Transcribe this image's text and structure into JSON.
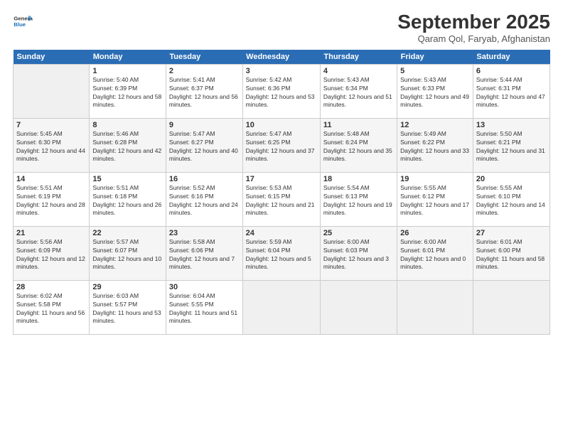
{
  "logo": {
    "general": "General",
    "blue": "Blue"
  },
  "title": "September 2025",
  "subtitle": "Qaram Qol, Faryab, Afghanistan",
  "headers": [
    "Sunday",
    "Monday",
    "Tuesday",
    "Wednesday",
    "Thursday",
    "Friday",
    "Saturday"
  ],
  "weeks": [
    [
      {
        "num": "",
        "rise": "",
        "set": "",
        "daylight": "",
        "empty": true
      },
      {
        "num": "1",
        "rise": "Sunrise: 5:40 AM",
        "set": "Sunset: 6:39 PM",
        "daylight": "Daylight: 12 hours and 58 minutes."
      },
      {
        "num": "2",
        "rise": "Sunrise: 5:41 AM",
        "set": "Sunset: 6:37 PM",
        "daylight": "Daylight: 12 hours and 56 minutes."
      },
      {
        "num": "3",
        "rise": "Sunrise: 5:42 AM",
        "set": "Sunset: 6:36 PM",
        "daylight": "Daylight: 12 hours and 53 minutes."
      },
      {
        "num": "4",
        "rise": "Sunrise: 5:43 AM",
        "set": "Sunset: 6:34 PM",
        "daylight": "Daylight: 12 hours and 51 minutes."
      },
      {
        "num": "5",
        "rise": "Sunrise: 5:43 AM",
        "set": "Sunset: 6:33 PM",
        "daylight": "Daylight: 12 hours and 49 minutes."
      },
      {
        "num": "6",
        "rise": "Sunrise: 5:44 AM",
        "set": "Sunset: 6:31 PM",
        "daylight": "Daylight: 12 hours and 47 minutes."
      }
    ],
    [
      {
        "num": "7",
        "rise": "Sunrise: 5:45 AM",
        "set": "Sunset: 6:30 PM",
        "daylight": "Daylight: 12 hours and 44 minutes."
      },
      {
        "num": "8",
        "rise": "Sunrise: 5:46 AM",
        "set": "Sunset: 6:28 PM",
        "daylight": "Daylight: 12 hours and 42 minutes."
      },
      {
        "num": "9",
        "rise": "Sunrise: 5:47 AM",
        "set": "Sunset: 6:27 PM",
        "daylight": "Daylight: 12 hours and 40 minutes."
      },
      {
        "num": "10",
        "rise": "Sunrise: 5:47 AM",
        "set": "Sunset: 6:25 PM",
        "daylight": "Daylight: 12 hours and 37 minutes."
      },
      {
        "num": "11",
        "rise": "Sunrise: 5:48 AM",
        "set": "Sunset: 6:24 PM",
        "daylight": "Daylight: 12 hours and 35 minutes."
      },
      {
        "num": "12",
        "rise": "Sunrise: 5:49 AM",
        "set": "Sunset: 6:22 PM",
        "daylight": "Daylight: 12 hours and 33 minutes."
      },
      {
        "num": "13",
        "rise": "Sunrise: 5:50 AM",
        "set": "Sunset: 6:21 PM",
        "daylight": "Daylight: 12 hours and 31 minutes."
      }
    ],
    [
      {
        "num": "14",
        "rise": "Sunrise: 5:51 AM",
        "set": "Sunset: 6:19 PM",
        "daylight": "Daylight: 12 hours and 28 minutes."
      },
      {
        "num": "15",
        "rise": "Sunrise: 5:51 AM",
        "set": "Sunset: 6:18 PM",
        "daylight": "Daylight: 12 hours and 26 minutes."
      },
      {
        "num": "16",
        "rise": "Sunrise: 5:52 AM",
        "set": "Sunset: 6:16 PM",
        "daylight": "Daylight: 12 hours and 24 minutes."
      },
      {
        "num": "17",
        "rise": "Sunrise: 5:53 AM",
        "set": "Sunset: 6:15 PM",
        "daylight": "Daylight: 12 hours and 21 minutes."
      },
      {
        "num": "18",
        "rise": "Sunrise: 5:54 AM",
        "set": "Sunset: 6:13 PM",
        "daylight": "Daylight: 12 hours and 19 minutes."
      },
      {
        "num": "19",
        "rise": "Sunrise: 5:55 AM",
        "set": "Sunset: 6:12 PM",
        "daylight": "Daylight: 12 hours and 17 minutes."
      },
      {
        "num": "20",
        "rise": "Sunrise: 5:55 AM",
        "set": "Sunset: 6:10 PM",
        "daylight": "Daylight: 12 hours and 14 minutes."
      }
    ],
    [
      {
        "num": "21",
        "rise": "Sunrise: 5:56 AM",
        "set": "Sunset: 6:09 PM",
        "daylight": "Daylight: 12 hours and 12 minutes."
      },
      {
        "num": "22",
        "rise": "Sunrise: 5:57 AM",
        "set": "Sunset: 6:07 PM",
        "daylight": "Daylight: 12 hours and 10 minutes."
      },
      {
        "num": "23",
        "rise": "Sunrise: 5:58 AM",
        "set": "Sunset: 6:06 PM",
        "daylight": "Daylight: 12 hours and 7 minutes."
      },
      {
        "num": "24",
        "rise": "Sunrise: 5:59 AM",
        "set": "Sunset: 6:04 PM",
        "daylight": "Daylight: 12 hours and 5 minutes."
      },
      {
        "num": "25",
        "rise": "Sunrise: 6:00 AM",
        "set": "Sunset: 6:03 PM",
        "daylight": "Daylight: 12 hours and 3 minutes."
      },
      {
        "num": "26",
        "rise": "Sunrise: 6:00 AM",
        "set": "Sunset: 6:01 PM",
        "daylight": "Daylight: 12 hours and 0 minutes."
      },
      {
        "num": "27",
        "rise": "Sunrise: 6:01 AM",
        "set": "Sunset: 6:00 PM",
        "daylight": "Daylight: 11 hours and 58 minutes."
      }
    ],
    [
      {
        "num": "28",
        "rise": "Sunrise: 6:02 AM",
        "set": "Sunset: 5:58 PM",
        "daylight": "Daylight: 11 hours and 56 minutes."
      },
      {
        "num": "29",
        "rise": "Sunrise: 6:03 AM",
        "set": "Sunset: 5:57 PM",
        "daylight": "Daylight: 11 hours and 53 minutes."
      },
      {
        "num": "30",
        "rise": "Sunrise: 6:04 AM",
        "set": "Sunset: 5:55 PM",
        "daylight": "Daylight: 11 hours and 51 minutes."
      },
      {
        "num": "",
        "rise": "",
        "set": "",
        "daylight": "",
        "empty": true
      },
      {
        "num": "",
        "rise": "",
        "set": "",
        "daylight": "",
        "empty": true
      },
      {
        "num": "",
        "rise": "",
        "set": "",
        "daylight": "",
        "empty": true
      },
      {
        "num": "",
        "rise": "",
        "set": "",
        "daylight": "",
        "empty": true
      }
    ]
  ]
}
